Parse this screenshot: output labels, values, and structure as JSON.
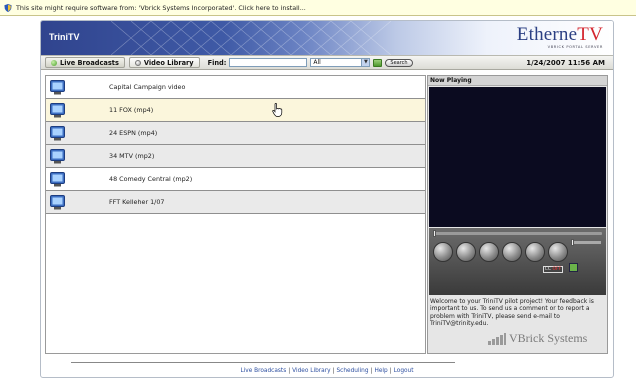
{
  "infobar": {
    "message": "This site might require software from: 'Vbrick Systems Incorporated'. Click here to install..."
  },
  "header": {
    "app_title": "TriniTV",
    "brand_main": "Etherne",
    "brand_tv": "TV",
    "brand_sub": "VBRICK PORTAL SERVER"
  },
  "toolbar": {
    "live_broadcasts": "Live Broadcasts",
    "video_library": "Video Library",
    "find_label": "Find:",
    "find_value": "",
    "scope_selected": "All",
    "search_label": "Search",
    "datetime": "1/24/2007 11:56 AM"
  },
  "list": {
    "items": [
      {
        "label": "Capital Campaign video"
      },
      {
        "label": "11 FOX (mp4)"
      },
      {
        "label": "24 ESPN (mp4)"
      },
      {
        "label": "34 MTV (mp2)"
      },
      {
        "label": "48 Comedy Central (mp2)"
      },
      {
        "label": "FFT Kelleher 1/07"
      }
    ]
  },
  "now_playing": {
    "title": "Now Playing",
    "cc_label_a": "CC",
    "cc_label_b": "OFF",
    "welcome": "Welcome to your TriniTV pilot project! Your feedback is important to us. To send us a comment or to report a problem with TriniTV, please send e-mail to TriniTV@trinity.edu.",
    "vendor": "VBrick Systems"
  },
  "footer": {
    "links": [
      "Live Broadcasts",
      "Video Library",
      "Scheduling",
      "Help",
      "Logout"
    ],
    "separator": "|"
  },
  "colors": {
    "header_dark": "#30448e",
    "brand_red": "#d4252e",
    "hover_row": "#fbf6dc",
    "video_bg": "#0b0b20",
    "link": "#2d4fa0"
  }
}
